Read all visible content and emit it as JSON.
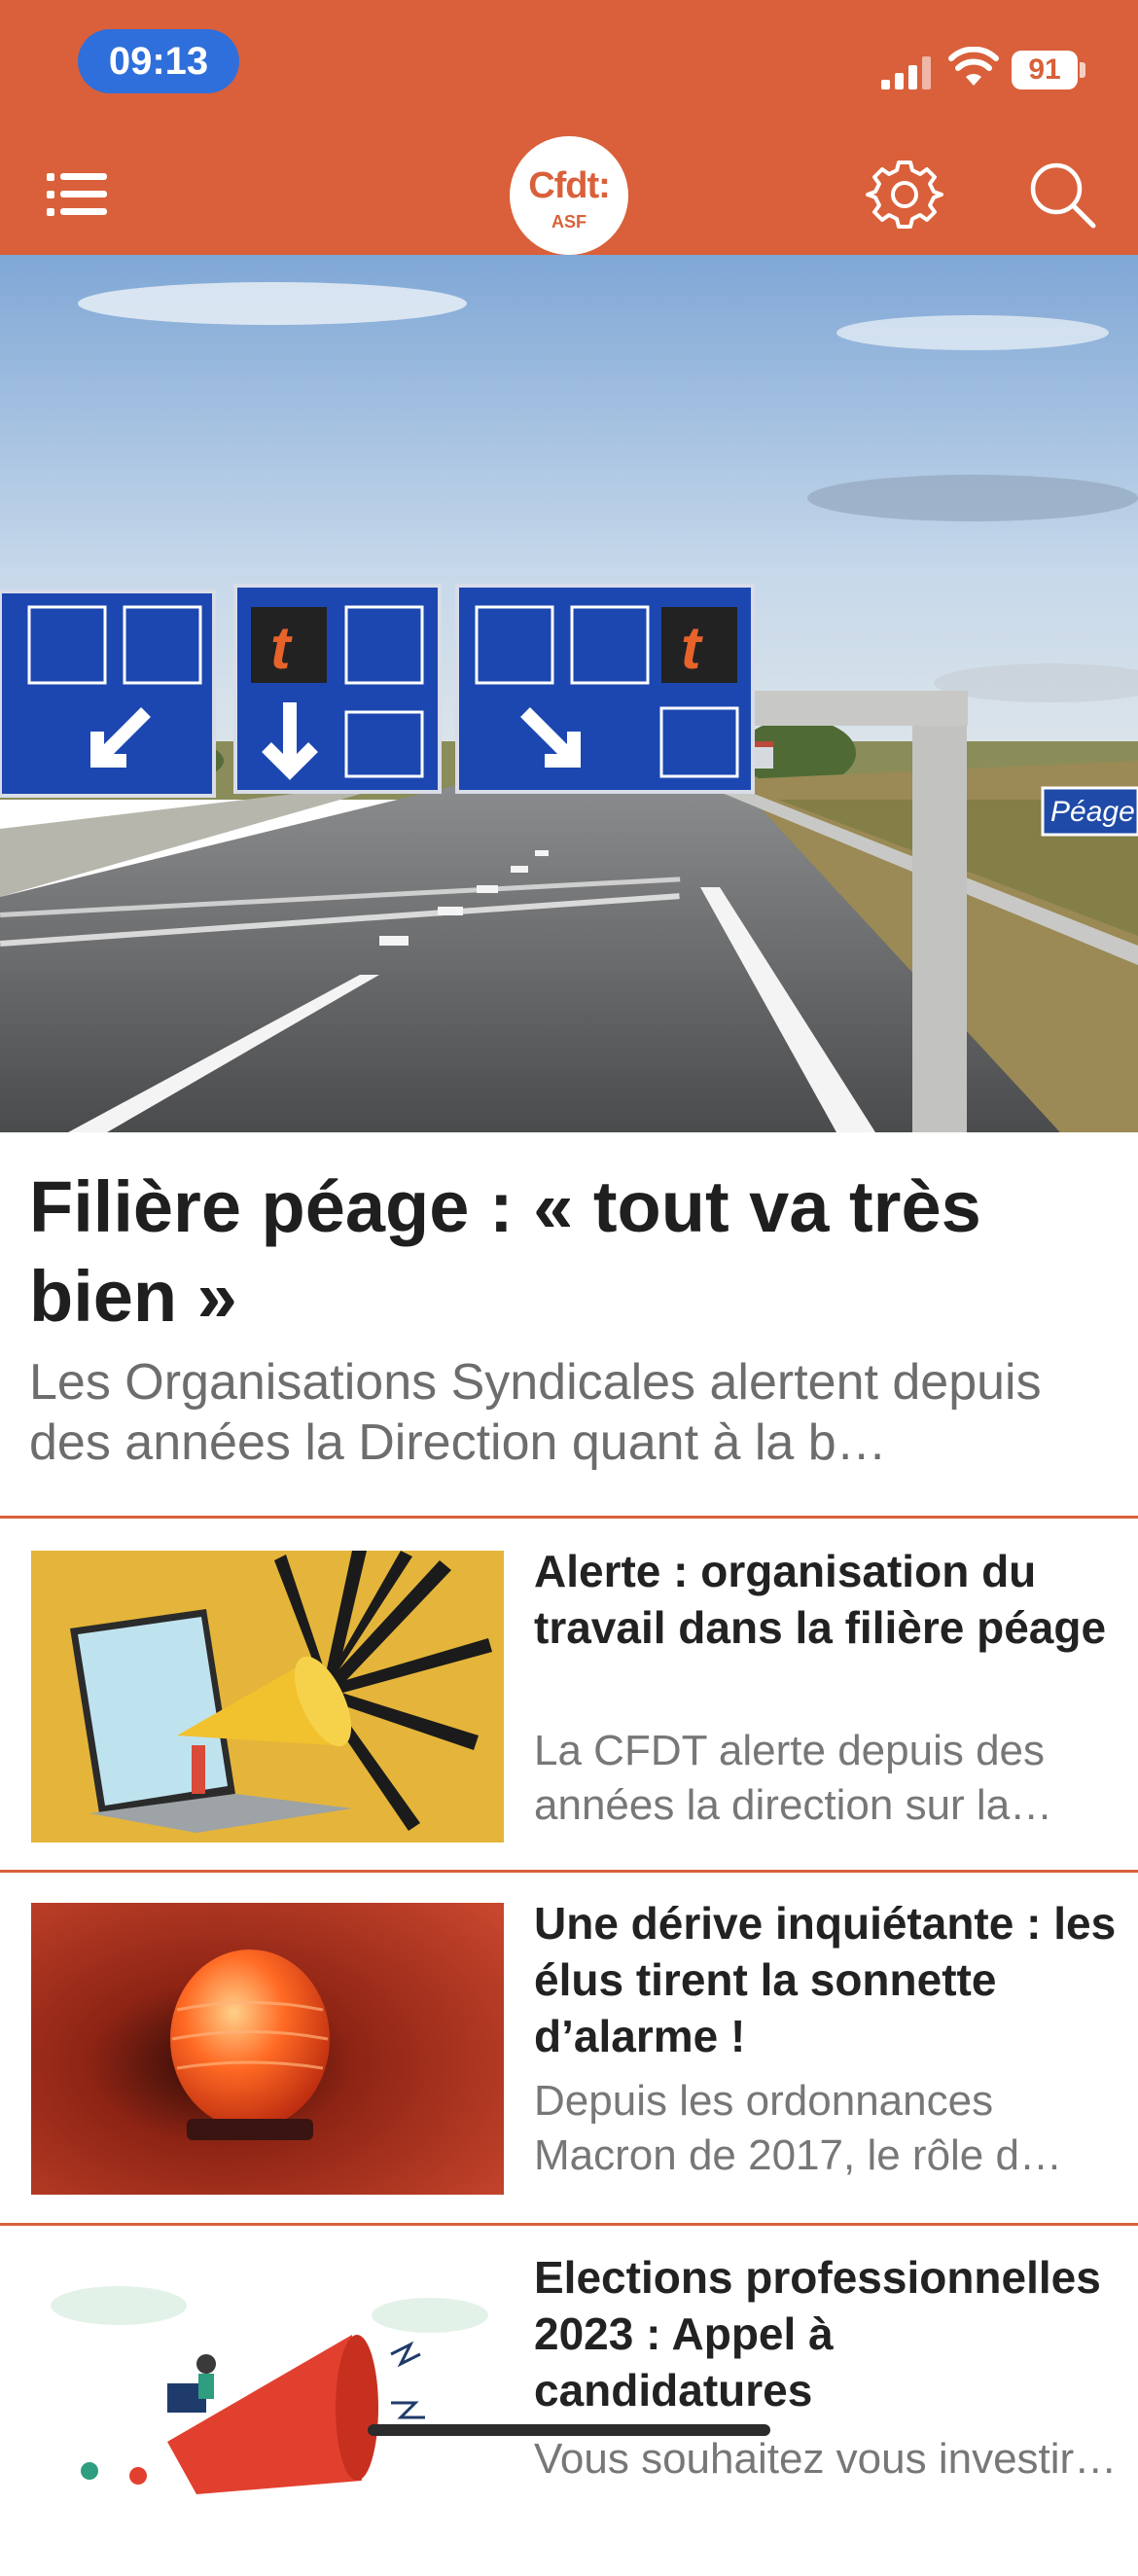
{
  "status": {
    "time": "09:13",
    "battery": "91"
  },
  "nav": {
    "logo_text": "Cfdt:",
    "logo_sub": "ASF"
  },
  "featured": {
    "title": "Filière péage : « tout va très bien »",
    "summary": "Les Organisations Syndicales alertent depuis des années la Direction quant à la b…",
    "image": "highway-toll-gantry-photo",
    "sign_text": "Péage"
  },
  "articles": [
    {
      "title": "Alerte : organisation du travail dans la filière péage",
      "summary": "La CFDT alerte depuis des années la direction sur la…",
      "image": "megaphone-laptop-illustration"
    },
    {
      "title": "Une dérive inquiétante : les élus tirent la sonnette d’alarme !",
      "summary": "Depuis les ordonnances Macron de 2017, le rôle d…",
      "image": "red-alarm-light-photo"
    },
    {
      "title": "Elections professionnelles 2023 : Appel à candidatures",
      "summary": "Vous souhaitez vous investir…",
      "image": "megaphone-people-illustration"
    }
  ],
  "colors": {
    "brand": "#d9603a",
    "status_pill": "#2f6fdb"
  }
}
